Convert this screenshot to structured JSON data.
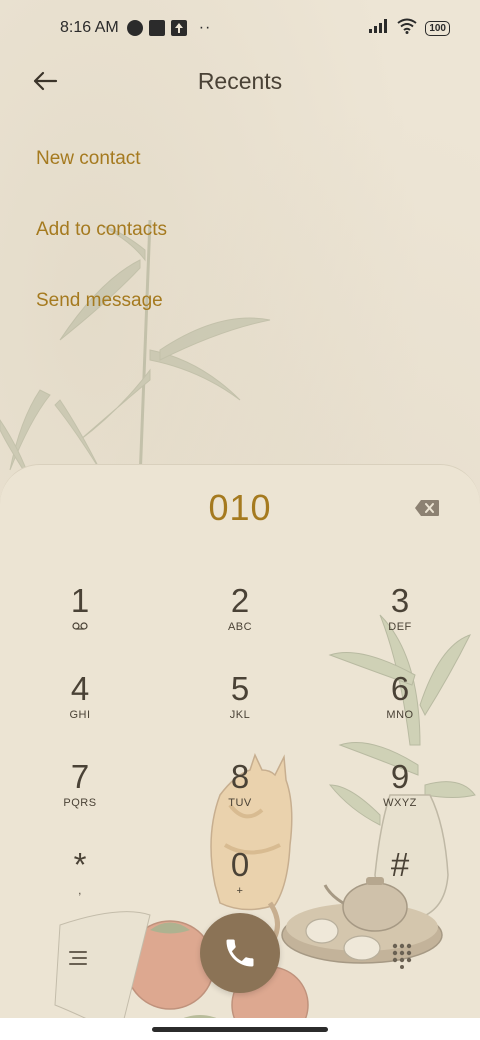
{
  "status_bar": {
    "time": "8:16 AM",
    "dots": "··",
    "battery": "100",
    "icons": [
      "vpn-circle-icon",
      "square-app-icon",
      "upload-icon",
      "signal-icon",
      "wifi-icon",
      "battery-icon"
    ]
  },
  "header": {
    "title": "Recents",
    "back_icon": "arrow-left-icon"
  },
  "actions": {
    "new_contact": "New contact",
    "add_to_contacts": "Add to contacts",
    "send_message": "Send message"
  },
  "dialer": {
    "number": "010",
    "keys": [
      {
        "digit": "1",
        "letters": ""
      },
      {
        "digit": "2",
        "letters": "ABC"
      },
      {
        "digit": "3",
        "letters": "DEF"
      },
      {
        "digit": "4",
        "letters": "GHI"
      },
      {
        "digit": "5",
        "letters": "JKL"
      },
      {
        "digit": "6",
        "letters": "MNO"
      },
      {
        "digit": "7",
        "letters": "PQRS"
      },
      {
        "digit": "8",
        "letters": "TUV"
      },
      {
        "digit": "9",
        "letters": "WXYZ"
      },
      {
        "digit": "*",
        "letters": ","
      },
      {
        "digit": "0",
        "letters": "+"
      },
      {
        "digit": "#",
        "letters": ""
      }
    ]
  },
  "colors": {
    "accent": "#a57a1f",
    "call_button": "#8b7356",
    "background": "#ede5d5"
  }
}
